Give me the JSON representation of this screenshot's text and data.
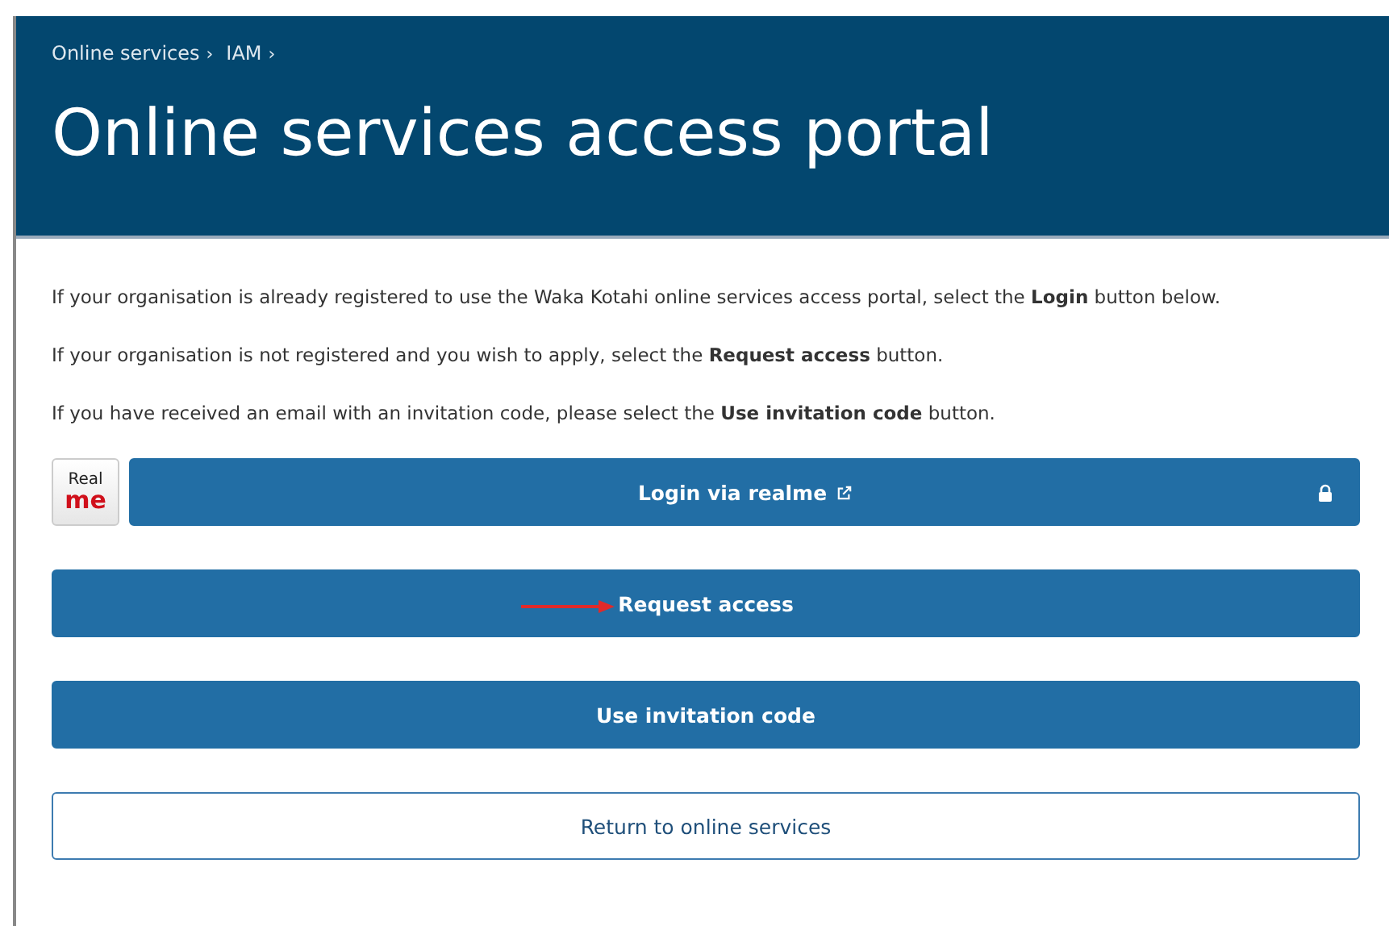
{
  "breadcrumbs": [
    {
      "label": "Online services",
      "separator": "›"
    },
    {
      "label": "IAM",
      "separator": "›"
    }
  ],
  "title": "Online services access portal",
  "paragraphs": [
    "If your organisation is already registered to use the Waka Kotahi online services access portal, select the **Login** button below.",
    "If your organisation is not registered and you wish to apply, select the **Request access** button.",
    "If you have received an email with an invitation code, please select the **Use invitation code** button."
  ],
  "logo": {
    "line_1": "Real",
    "line_2": "me"
  },
  "buttons": [
    {
      "label": "Login via realme",
      "kind": "primary",
      "external": true,
      "locked": true,
      "logo": true,
      "annotated": false
    },
    {
      "label": "Request access",
      "kind": "primary",
      "external": false,
      "locked": false,
      "logo": false,
      "annotated": true
    },
    {
      "label": "Use invitation code",
      "kind": "primary",
      "external": false,
      "locked": false,
      "logo": false,
      "annotated": false
    },
    {
      "label": "Return to online services",
      "kind": "secondary",
      "external": false,
      "locked": false,
      "logo": false,
      "annotated": false
    }
  ]
}
